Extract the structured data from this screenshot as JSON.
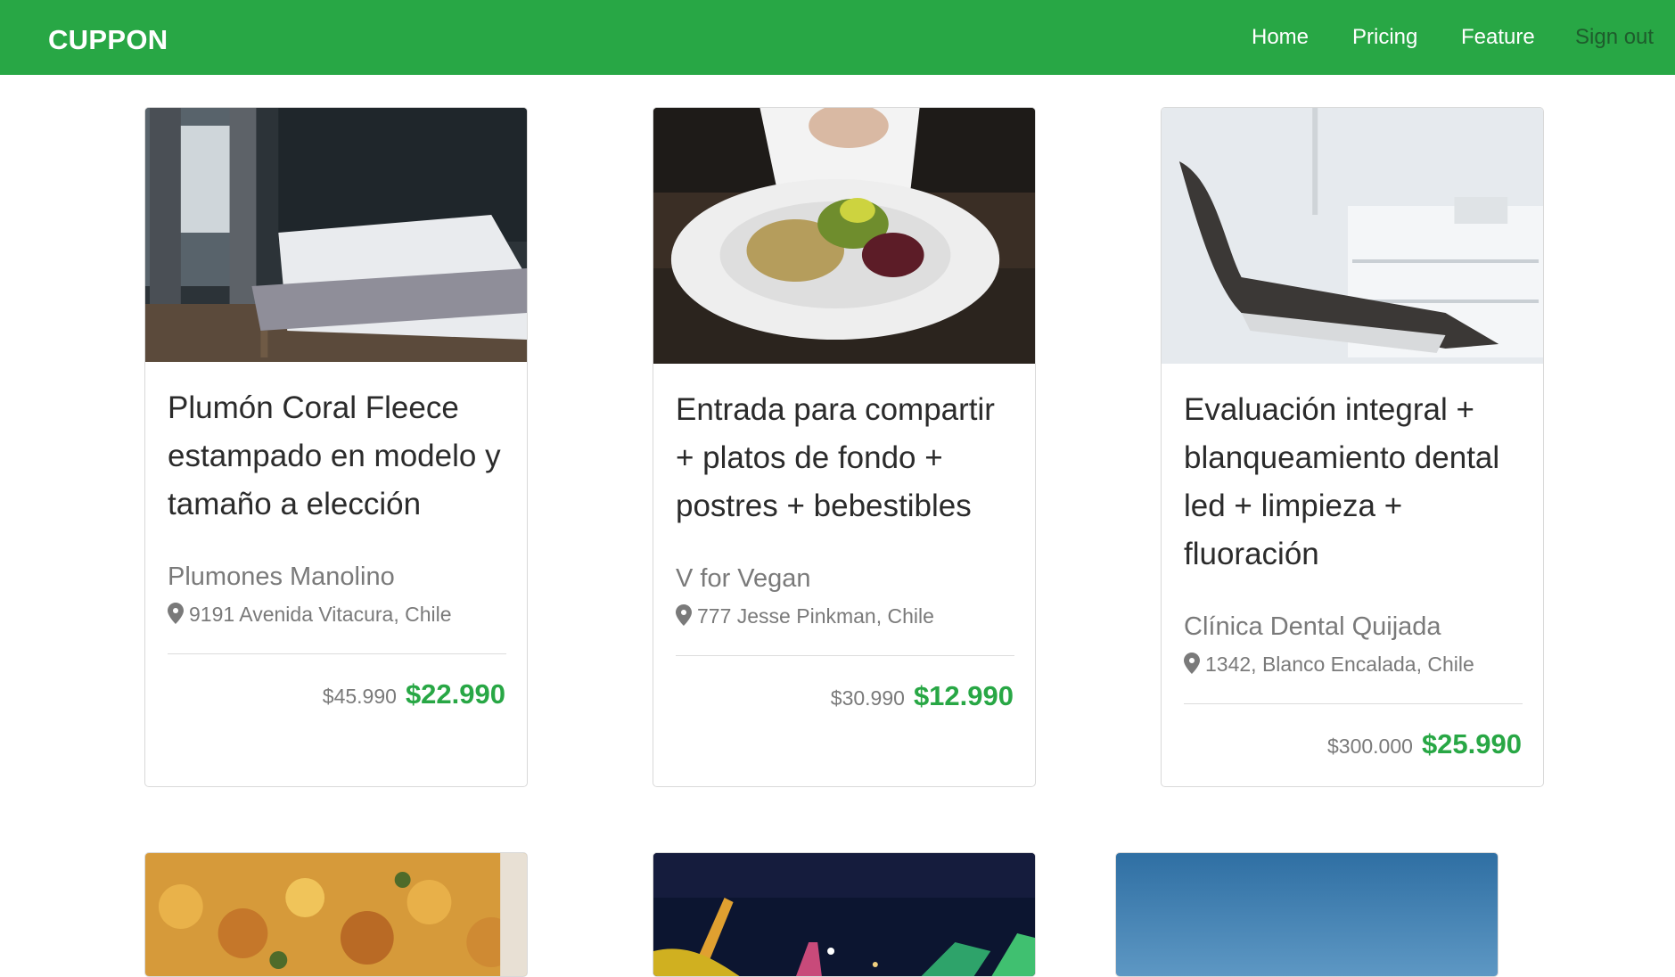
{
  "brand": "CUPPON",
  "nav": {
    "home": "Home",
    "pricing": "Pricing",
    "feature": "Feature",
    "signout": "Sign out"
  },
  "colors": {
    "accent": "#28a745",
    "muted_text": "#7a7a7a"
  },
  "deals": [
    {
      "image": "bedroom-photo",
      "title": "Plumón Coral Fleece estampado en modelo y tamaño a elección",
      "merchant": "Plumones Manolino",
      "address": "9191 Avenida Vitacura, Chile",
      "old_price": "$45.990",
      "new_price": "$22.990"
    },
    {
      "image": "vegan-plate-photo",
      "title": "Entrada para compartir + platos de fondo + postres + bebestibles",
      "merchant": "V for Vegan",
      "address": "777 Jesse Pinkman, Chile",
      "old_price": "$30.990",
      "new_price": "$12.990"
    },
    {
      "image": "dental-chair-photo",
      "title": "Evaluación integral + blanqueamiento dental led + limpieza + fluoración",
      "merchant": "Clínica Dental Quijada",
      "address": "1342, Blanco Encalada, Chile",
      "old_price": "$300.000",
      "new_price": "$25.990"
    }
  ],
  "next_row_images": [
    "food-closeup-photo",
    "night-lights-photo",
    "blue-sky-photo"
  ]
}
